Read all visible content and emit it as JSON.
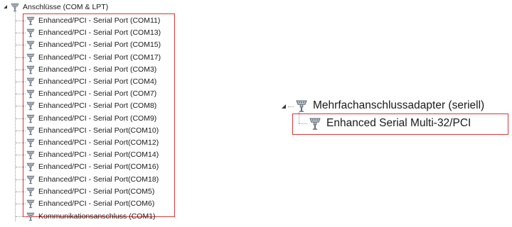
{
  "ports_tree": {
    "category_label": "Anschlüsse (COM & LPT)",
    "highlighted_ports": [
      "Enhanced/PCI - Serial Port (COM11)",
      "Enhanced/PCI - Serial Port (COM13)",
      "Enhanced/PCI - Serial Port (COM15)",
      "Enhanced/PCI - Serial Port (COM17)",
      "Enhanced/PCI - Serial Port (COM3)",
      "Enhanced/PCI - Serial Port (COM4)",
      "Enhanced/PCI - Serial Port (COM7)",
      "Enhanced/PCI - Serial Port (COM8)",
      "Enhanced/PCI - Serial Port (COM9)",
      "Enhanced/PCI - Serial Port(COM10)",
      "Enhanced/PCI - Serial Port(COM12)",
      "Enhanced/PCI - Serial Port(COM14)",
      "Enhanced/PCI - Serial Port(COM16)",
      "Enhanced/PCI - Serial Port(COM18)",
      "Enhanced/PCI - Serial Port(COM5)",
      "Enhanced/PCI - Serial Port(COM6)"
    ],
    "last_port": "Kommunikationsanschluss (COM1)"
  },
  "adapter_tree": {
    "category_label": "Mehrfachanschlussadapter (seriell)",
    "device_label": "Enhanced Serial Multi-32/PCI"
  },
  "colors": {
    "highlight_border": "#e03434",
    "tree_line": "#9a9a9a",
    "text": "#1a1a1a"
  },
  "icons": {
    "category": "serial-port-icon",
    "device": "serial-port-icon"
  }
}
